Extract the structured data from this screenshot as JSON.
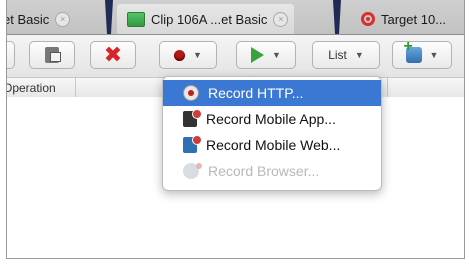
{
  "tabs": [
    {
      "label": "et Basic",
      "close": "×"
    },
    {
      "label": "Clip 106A ...et Basic",
      "close": "×"
    },
    {
      "label": "Target 10..."
    }
  ],
  "toolbar": {
    "caret": "▼",
    "delete_glyph": "✖",
    "list_label": "List"
  },
  "table": {
    "column_operation": "Operation"
  },
  "record_menu": {
    "items": [
      {
        "label": "Record HTTP...",
        "icon": "record-http-icon",
        "state": "selected"
      },
      {
        "label": "Record Mobile App...",
        "icon": "mobile-app-icon",
        "state": "enabled"
      },
      {
        "label": "Record Mobile Web...",
        "icon": "mobile-web-icon",
        "state": "enabled"
      },
      {
        "label": "Record Browser...",
        "icon": "browser-icon",
        "state": "disabled"
      }
    ]
  },
  "colors": {
    "selection": "#3a78d4",
    "delete_red": "#d8232a",
    "record_red": "#b11a1a"
  }
}
